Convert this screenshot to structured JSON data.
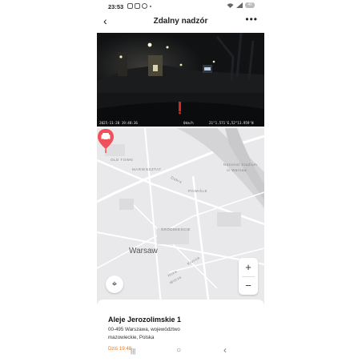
{
  "status_bar": {
    "time": "23:53",
    "battery": "40"
  },
  "header": {
    "title": "Zdalny nadzór",
    "back_icon": "back-arrow-icon",
    "more_icon": "more-dots-icon",
    "back_glyph": "‹",
    "more_glyph": "•••"
  },
  "video": {
    "timestamp": "2025-11-28 19:48:36",
    "speed": "0km/h",
    "coordinates": "21°1.571'E,52°13.959'N"
  },
  "map": {
    "labels": [
      "OLD TOWN",
      "MARIENSZTAT",
      "Dobra",
      "National Stadium",
      "in Warsaw",
      "POWIŚLE",
      "ŚRÓDMIEŚCIE",
      "Krucza",
      "Wilcza",
      "Hoża"
    ],
    "city_label": "Warsaw",
    "zoom_in": "+",
    "zoom_out": "−",
    "locate_icon": "⌖",
    "pin_color": "#f0505a"
  },
  "address": {
    "title": "Aleje Jerozolimskie 1",
    "line1": "00-495 Warszawa, województwo",
    "line2": "mazowieckie, Polska",
    "time": "Dziś 19:48"
  },
  "navbar": {
    "recents": "|||",
    "home": "○",
    "back": "‹"
  }
}
